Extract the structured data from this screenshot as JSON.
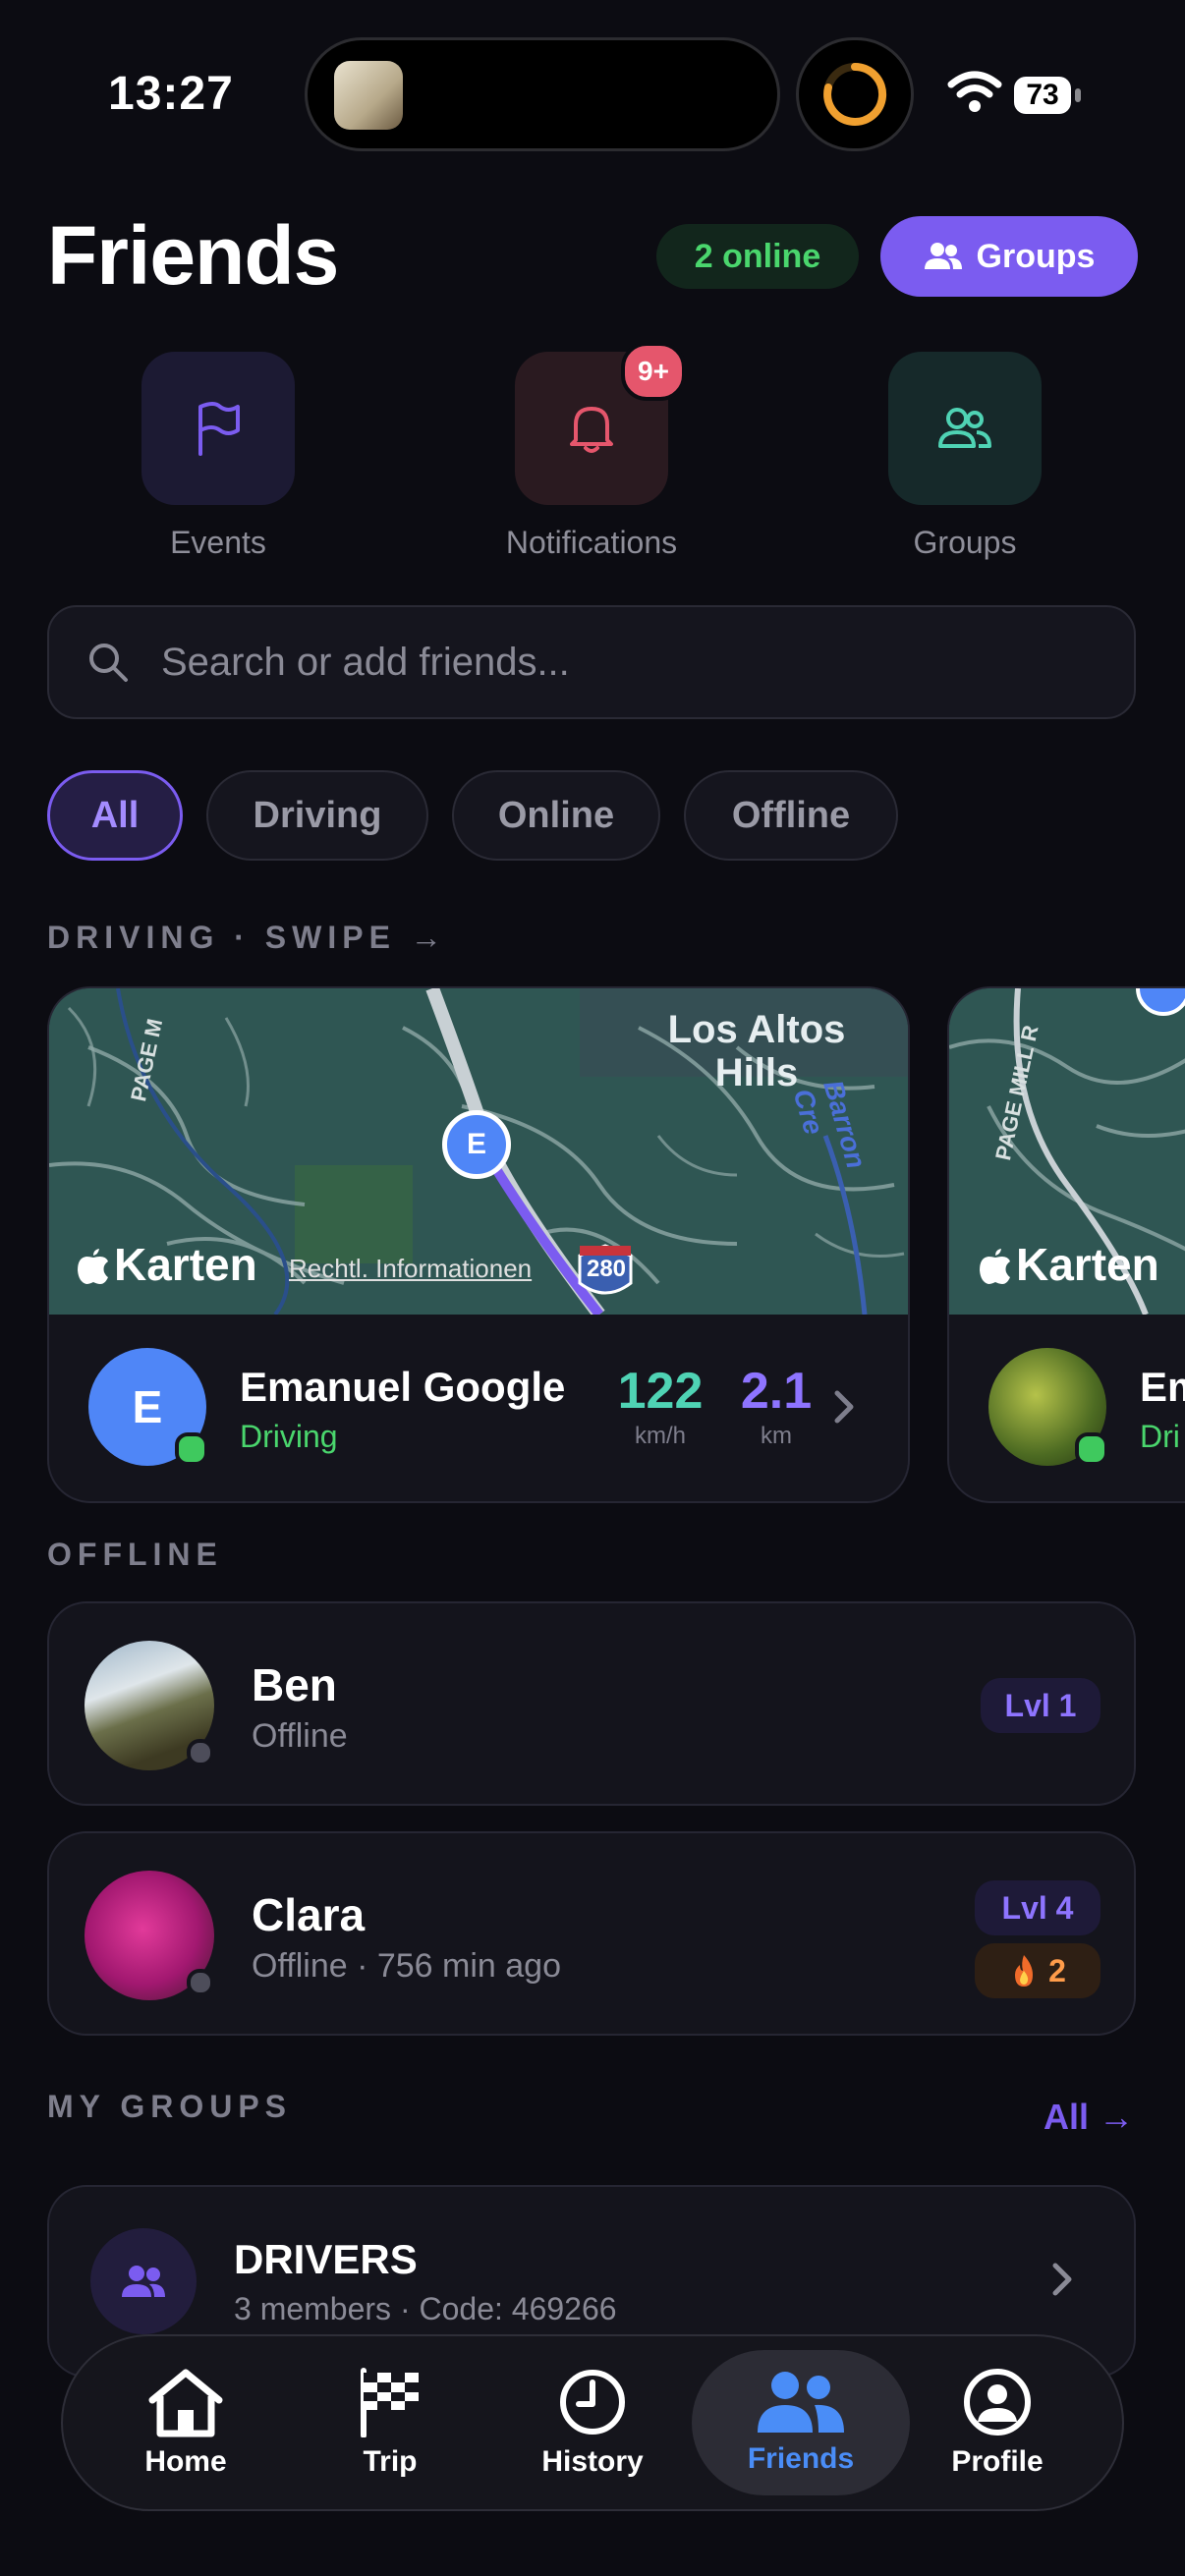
{
  "status_bar": {
    "time": "13:27",
    "battery": "73"
  },
  "header": {
    "title": "Friends",
    "online_badge": "2 online",
    "groups_button": "Groups"
  },
  "quick_actions": [
    {
      "label": "Events",
      "icon": "flag-icon",
      "color": "#7b5cf0",
      "bg": "#1c1a33"
    },
    {
      "label": "Notifications",
      "icon": "bell-icon",
      "color": "#e5566c",
      "bg": "#2a1a20",
      "badge": "9+"
    },
    {
      "label": "Groups",
      "icon": "people-icon",
      "color": "#4fd3b4",
      "bg": "#16292a"
    }
  ],
  "search": {
    "placeholder": "Search or add friends..."
  },
  "filters": [
    "All",
    "Driving",
    "Online",
    "Offline"
  ],
  "driving_section": {
    "label": "DRIVING · SWIPE →",
    "cards": [
      {
        "map": {
          "place": "Los Altos Hills",
          "road_label": "PAGE M",
          "creek_label": "Barron Cre",
          "highway": "280",
          "brand": "Karten",
          "legal": "Rechtl. Informationen",
          "marker": "E"
        },
        "initial": "E",
        "name": "Emanuel Google",
        "status": "Driving",
        "speed": "122",
        "speed_unit": "km/h",
        "distance": "2.1",
        "distance_unit": "km"
      },
      {
        "map": {
          "road_label": "PAGE MILL R",
          "brand": "Karten"
        },
        "name": "Em",
        "status": "Dri"
      }
    ]
  },
  "offline_section": {
    "label": "OFFLINE",
    "friends": [
      {
        "name": "Ben",
        "status": "Offline",
        "level": "Lvl 1"
      },
      {
        "name": "Clara",
        "status": "Offline · 756 min ago",
        "level": "Lvl 4",
        "streak": "2"
      }
    ]
  },
  "groups_section": {
    "label": "MY GROUPS",
    "all_link": "All →",
    "groups": [
      {
        "name": "DRIVERS",
        "meta": "3 members · Code: 469266"
      }
    ]
  },
  "tabbar": [
    {
      "label": "Home",
      "icon": "home-icon"
    },
    {
      "label": "Trip",
      "icon": "checkered-flag-icon"
    },
    {
      "label": "History",
      "icon": "clock-icon"
    },
    {
      "label": "Friends",
      "icon": "friends-icon",
      "active": true
    },
    {
      "label": "Profile",
      "icon": "profile-icon"
    }
  ]
}
